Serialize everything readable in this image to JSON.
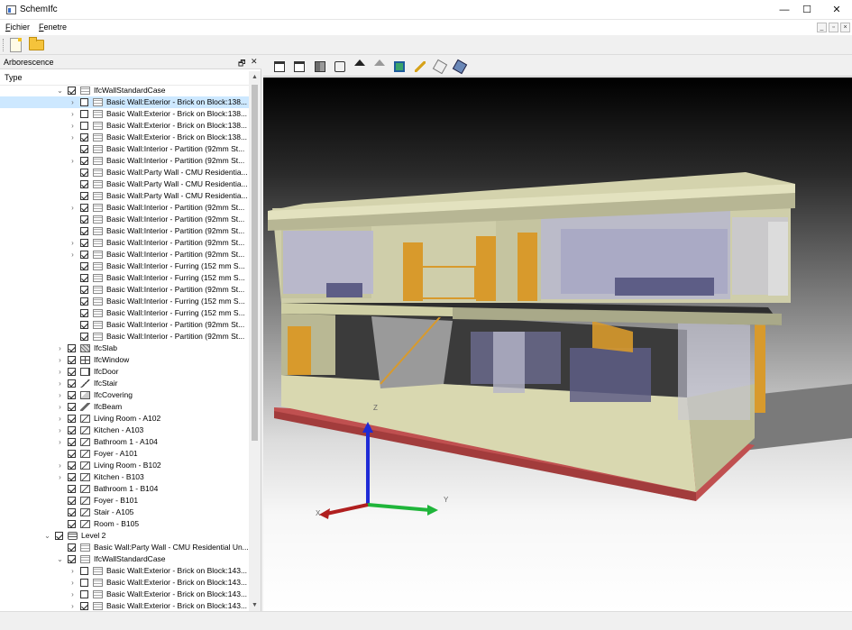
{
  "window": {
    "title": "SchemIfc",
    "minimize": "—",
    "maximize": "☐",
    "close": "✕"
  },
  "menu": {
    "fichier": "Fichier",
    "fenetre": "Fenetre"
  },
  "dock": {
    "title": "Arborescence",
    "float": "🗗",
    "close": "✕",
    "column": "Type"
  },
  "viewport": {
    "axis_z": "Z",
    "axis_y": "Y",
    "axis_x": "X"
  },
  "tree": [
    {
      "label": "IfcWallStandardCase",
      "indent": 0,
      "arrow": "v",
      "checked": true,
      "icon": "wall"
    },
    {
      "label": "Basic Wall:Exterior - Brick on Block:138...",
      "indent": 1,
      "arrow": ">",
      "checked": false,
      "icon": "wall",
      "selected": true
    },
    {
      "label": "Basic Wall:Exterior - Brick on Block:138...",
      "indent": 1,
      "arrow": ">",
      "checked": false,
      "icon": "wall"
    },
    {
      "label": "Basic Wall:Exterior - Brick on Block:138...",
      "indent": 1,
      "arrow": ">",
      "checked": false,
      "icon": "wall"
    },
    {
      "label": "Basic Wall:Exterior - Brick on Block:138...",
      "indent": 1,
      "arrow": ">",
      "checked": true,
      "icon": "wall"
    },
    {
      "label": "Basic Wall:Interior - Partition (92mm St...",
      "indent": 1,
      "arrow": "",
      "checked": true,
      "icon": "wall"
    },
    {
      "label": "Basic Wall:Interior - Partition (92mm St...",
      "indent": 1,
      "arrow": ">",
      "checked": true,
      "icon": "wall"
    },
    {
      "label": "Basic Wall:Party Wall - CMU Residentia...",
      "indent": 1,
      "arrow": "",
      "checked": true,
      "icon": "wall"
    },
    {
      "label": "Basic Wall:Party Wall - CMU Residentia...",
      "indent": 1,
      "arrow": "",
      "checked": true,
      "icon": "wall"
    },
    {
      "label": "Basic Wall:Party Wall - CMU Residentia...",
      "indent": 1,
      "arrow": "",
      "checked": true,
      "icon": "wall"
    },
    {
      "label": "Basic Wall:Interior - Partition (92mm St...",
      "indent": 1,
      "arrow": ">",
      "checked": true,
      "icon": "wall"
    },
    {
      "label": "Basic Wall:Interior - Partition (92mm St...",
      "indent": 1,
      "arrow": "",
      "checked": true,
      "icon": "wall"
    },
    {
      "label": "Basic Wall:Interior - Partition (92mm St...",
      "indent": 1,
      "arrow": "",
      "checked": true,
      "icon": "wall"
    },
    {
      "label": "Basic Wall:Interior - Partition (92mm St...",
      "indent": 1,
      "arrow": ">",
      "checked": true,
      "icon": "wall"
    },
    {
      "label": "Basic Wall:Interior - Partition (92mm St...",
      "indent": 1,
      "arrow": ">",
      "checked": true,
      "icon": "wall"
    },
    {
      "label": "Basic Wall:Interior - Furring (152 mm S...",
      "indent": 1,
      "arrow": "",
      "checked": true,
      "icon": "wall"
    },
    {
      "label": "Basic Wall:Interior - Furring (152 mm S...",
      "indent": 1,
      "arrow": "",
      "checked": true,
      "icon": "wall"
    },
    {
      "label": "Basic Wall:Interior - Partition (92mm St...",
      "indent": 1,
      "arrow": "",
      "checked": true,
      "icon": "wall"
    },
    {
      "label": "Basic Wall:Interior - Furring (152 mm S...",
      "indent": 1,
      "arrow": "",
      "checked": true,
      "icon": "wall"
    },
    {
      "label": "Basic Wall:Interior - Furring (152 mm S...",
      "indent": 1,
      "arrow": "",
      "checked": true,
      "icon": "wall"
    },
    {
      "label": "Basic Wall:Interior - Partition (92mm St...",
      "indent": 1,
      "arrow": "",
      "checked": true,
      "icon": "wall"
    },
    {
      "label": "Basic Wall:Interior - Partition (92mm St...",
      "indent": 1,
      "arrow": "",
      "checked": true,
      "icon": "wall"
    },
    {
      "label": "IfcSlab",
      "indent": 0,
      "arrow": ">",
      "checked": true,
      "icon": "slab"
    },
    {
      "label": "IfcWindow",
      "indent": 0,
      "arrow": ">",
      "checked": true,
      "icon": "win"
    },
    {
      "label": "IfcDoor",
      "indent": 0,
      "arrow": ">",
      "checked": true,
      "icon": "door"
    },
    {
      "label": "IfcStair",
      "indent": 0,
      "arrow": ">",
      "checked": true,
      "icon": "stair"
    },
    {
      "label": "IfcCovering",
      "indent": 0,
      "arrow": ">",
      "checked": true,
      "icon": "cover"
    },
    {
      "label": "IfcBeam",
      "indent": 0,
      "arrow": ">",
      "checked": true,
      "icon": "beam"
    },
    {
      "label": "Living Room - A102",
      "indent": 0,
      "arrow": ">",
      "checked": true,
      "icon": "space"
    },
    {
      "label": "Kitchen - A103",
      "indent": 0,
      "arrow": ">",
      "checked": true,
      "icon": "space"
    },
    {
      "label": "Bathroom 1 - A104",
      "indent": 0,
      "arrow": ">",
      "checked": true,
      "icon": "space"
    },
    {
      "label": "Foyer - A101",
      "indent": 0,
      "arrow": "",
      "checked": true,
      "icon": "space"
    },
    {
      "label": "Living Room - B102",
      "indent": 0,
      "arrow": ">",
      "checked": true,
      "icon": "space"
    },
    {
      "label": "Kitchen - B103",
      "indent": 0,
      "arrow": ">",
      "checked": true,
      "icon": "space"
    },
    {
      "label": "Bathroom 1 - B104",
      "indent": 0,
      "arrow": "",
      "checked": true,
      "icon": "space"
    },
    {
      "label": "Foyer - B101",
      "indent": 0,
      "arrow": "",
      "checked": true,
      "icon": "space"
    },
    {
      "label": "Stair - A105",
      "indent": 0,
      "arrow": "",
      "checked": true,
      "icon": "space"
    },
    {
      "label": "Room - B105",
      "indent": 0,
      "arrow": "",
      "checked": true,
      "icon": "space"
    },
    {
      "label": "Level 2",
      "indent": -1,
      "arrow": "v",
      "checked": true,
      "icon": "level"
    },
    {
      "label": "Basic Wall:Party Wall - CMU Residential Un...",
      "indent": 0,
      "arrow": "",
      "checked": true,
      "icon": "wall"
    },
    {
      "label": "IfcWallStandardCase",
      "indent": 0,
      "arrow": "v",
      "checked": true,
      "icon": "wall"
    },
    {
      "label": "Basic Wall:Exterior - Brick on Block:143...",
      "indent": 1,
      "arrow": ">",
      "checked": false,
      "icon": "wall"
    },
    {
      "label": "Basic Wall:Exterior - Brick on Block:143...",
      "indent": 1,
      "arrow": ">",
      "checked": false,
      "icon": "wall"
    },
    {
      "label": "Basic Wall:Exterior - Brick on Block:143...",
      "indent": 1,
      "arrow": ">",
      "checked": false,
      "icon": "wall"
    },
    {
      "label": "Basic Wall:Exterior - Brick on Block:143...",
      "indent": 1,
      "arrow": ">",
      "checked": true,
      "icon": "wall"
    }
  ]
}
